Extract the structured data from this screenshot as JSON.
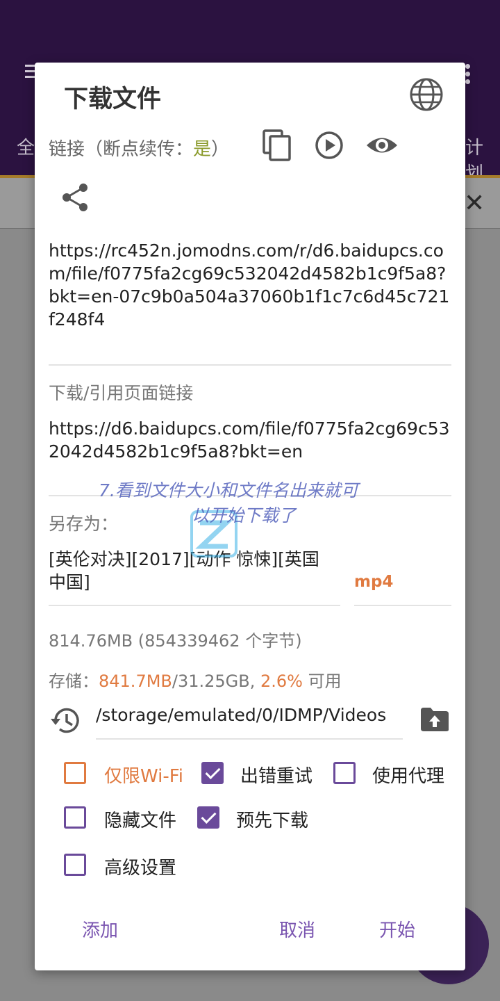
{
  "background": {
    "tab_left_fragment": "全",
    "tab_right_fragment": "计划"
  },
  "dialog": {
    "title": "下载文件",
    "link_label_prefix": "链接（断点续传：",
    "link_label_value": "是",
    "link_label_suffix": "）",
    "url": "https://rc452n.jomodns.com/r/d6.baidupcs.com/file/f0775fa2cg69c532042d4582b1c9f5a8?bkt=en-07c9b0a504a37060b1f1c7c6d45c721f248f4",
    "referer_label": "下载/引用页面链接",
    "referer_url": "https://d6.baidupcs.com/file/f0775fa2cg69c532042d4582b1c9f5a8?bkt=en",
    "save_as_label": "另存为：",
    "filename": "[英伦对决][2017][动作 惊悚][英国 中国]",
    "extension": "mp4",
    "size_text": "814.76MB (854339462 个字节)",
    "storage_prefix": "存储：",
    "storage_used": "841.7MB",
    "storage_total": "/31.25GB, ",
    "storage_percent": "2.6%",
    "storage_suffix": " 可用",
    "path": "/storage/emulated/0/IDMP/Videos",
    "options": {
      "wifi_only": {
        "label": "仅限Wi-Fi",
        "checked": false
      },
      "retry_on_error": {
        "label": "出错重试",
        "checked": true
      },
      "use_proxy": {
        "label": "使用代理",
        "checked": false
      },
      "hidden_file": {
        "label": "隐藏文件",
        "checked": false
      },
      "pre_download": {
        "label": "预先下载",
        "checked": true
      },
      "advanced": {
        "label": "高级设置",
        "checked": false
      }
    },
    "buttons": {
      "add": "添加",
      "cancel": "取消",
      "start": "开始"
    }
  },
  "watermark": {
    "line1": "7.看到文件大小和文件名出来就可",
    "line2": "以开始下载了"
  },
  "colors": {
    "accent": "#6a4a9a",
    "highlight": "#e07a40",
    "appbar": "#2b1240"
  }
}
